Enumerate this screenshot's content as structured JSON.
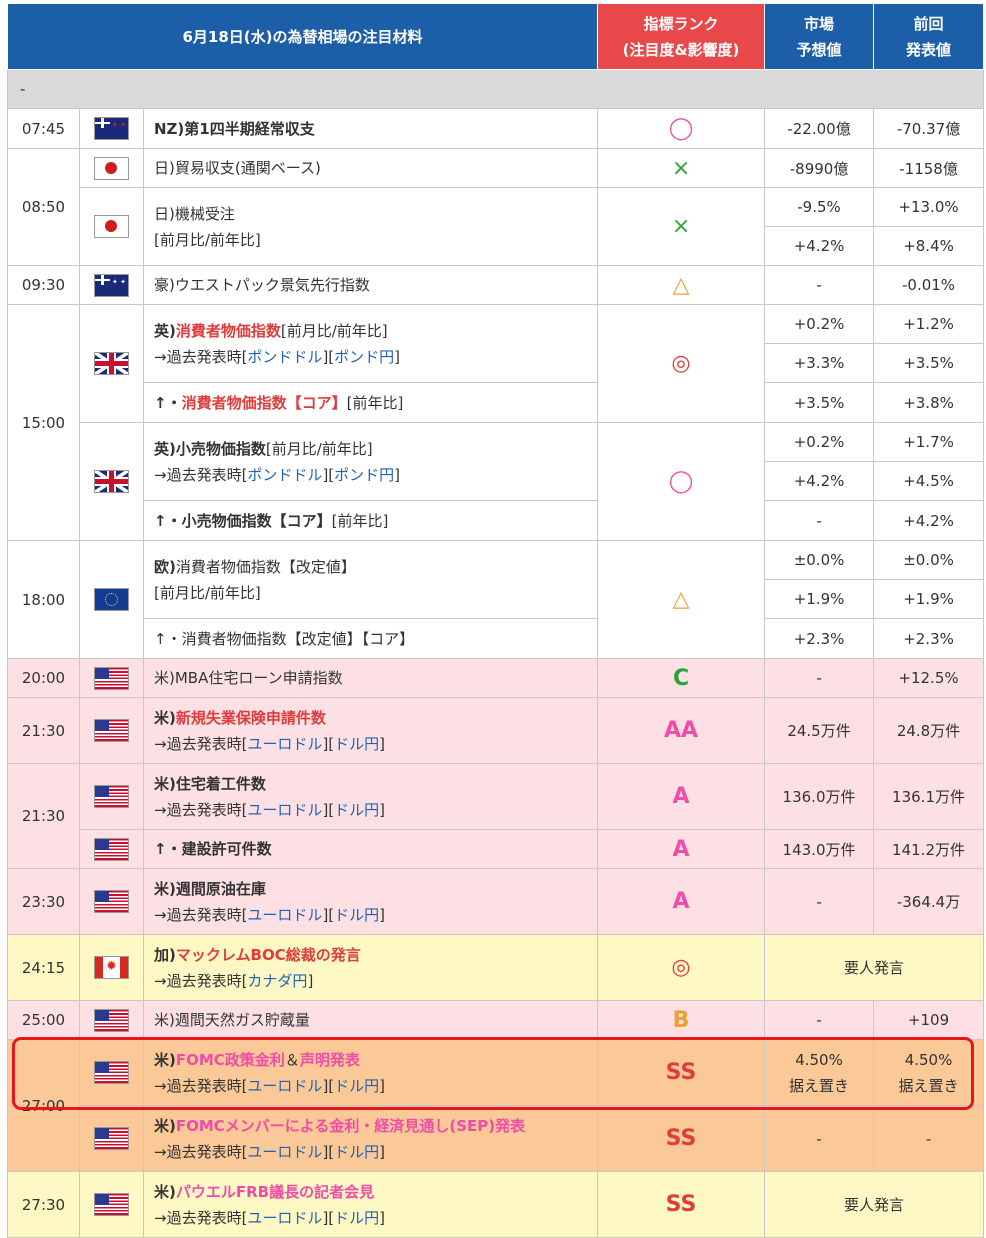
{
  "header": {
    "title": "6月18日(水)の為替相場の注目材料",
    "rank_line1": "指標ランク",
    "rank_line2": "(注目度&影響度)",
    "market_line1": "市場",
    "market_line2": "予想値",
    "prev_line1": "前回",
    "prev_line2": "発表値"
  },
  "separator": "-",
  "links": {
    "pound_dollar": "ポンドドル",
    "pound_yen": "ポンド円",
    "euro_dollar": "ユーロドル",
    "dollar_yen": "ドル円",
    "cad_yen": "カナダ円"
  },
  "text": {
    "past_prefix": "→過去発表時[",
    "bracket_mid": "][",
    "bracket_end": "]",
    "ampersand": "＆"
  },
  "rows": {
    "r1": {
      "time": "07:45",
      "flag": "nz-flag",
      "event": "NZ)第1四半期経常収支",
      "mark": "◯",
      "forecast": "-22.00億",
      "prev": "-70.37億"
    },
    "r2": {
      "time": "08:50",
      "flag": "jp-flag",
      "event": "日)貿易収支(通関ベース)",
      "mark": "×",
      "forecast": "-8990億",
      "prev": "-1158億"
    },
    "r3": {
      "flag": "jp-flag",
      "event": "日)機械受注",
      "sub": "[前月比/前年比]",
      "mark": "×",
      "forecast1": "-9.5%",
      "prev1": "+13.0%",
      "forecast2": "+4.2%",
      "prev2": "+8.4%"
    },
    "r4": {
      "time": "09:30",
      "flag": "au-flag",
      "event": "豪)ウエストパック景気先行指数",
      "mark": "△",
      "forecast": "-",
      "prev": "-0.01%"
    },
    "r5": {
      "time": "15:00",
      "flag": "uk-flag",
      "prefix": "英)",
      "event_hl": "消費者物価指数",
      "suffix": "[前月比/前年比]",
      "mark": "◎",
      "forecast1": "+0.2%",
      "prev1": "+1.2%",
      "forecast2": "+3.3%",
      "prev2": "+3.5%",
      "core_prefix": "↑・",
      "core_hl": "消費者物価指数【コア】",
      "core_suffix": "[前年比]",
      "forecast3": "+3.5%",
      "prev3": "+3.8%"
    },
    "r6": {
      "flag": "uk-flag",
      "prefix": "英)",
      "event_b": "小売物価指数",
      "suffix": "[前月比/前年比]",
      "mark": "◯",
      "forecast1": "+0.2%",
      "prev1": "+1.7%",
      "forecast2": "+4.2%",
      "prev2": "+4.5%",
      "core_prefix": "↑・",
      "core_b": "小売物価指数【コア】",
      "core_suffix": "[前年比]",
      "forecast3": "-",
      "prev3": "+4.2%"
    },
    "r7": {
      "time": "18:00",
      "flag": "eu-flag",
      "prefix": "欧)",
      "event": "消費者物価指数【改定値】",
      "sub": "[前月比/前年比]",
      "mark": "△",
      "forecast1": "±0.0%",
      "prev1": "±0.0%",
      "forecast2": "+1.9%",
      "prev2": "+1.9%",
      "core": "↑・消費者物価指数【改定値】【コア】",
      "forecast3": "+2.3%",
      "prev3": "+2.3%"
    },
    "r8": {
      "time": "20:00",
      "flag": "us-flag",
      "event": "米)MBA住宅ローン申請指数",
      "rank": "C",
      "forecast": "-",
      "prev": "+12.5%"
    },
    "r9": {
      "time": "21:30",
      "flag": "us-flag",
      "prefix": "米)",
      "event_hl": "新規失業保険申請件数",
      "rank": "AA",
      "forecast": "24.5万件",
      "prev": "24.8万件"
    },
    "r10": {
      "time": "21:30",
      "flag": "us-flag",
      "prefix": "米)",
      "event_b": "住宅着工件数",
      "rank": "A",
      "forecast": "136.0万件",
      "prev": "136.1万件",
      "sub_event": "↑・建設許可件数",
      "sub_rank": "A",
      "sub_forecast": "143.0万件",
      "sub_prev": "141.2万件"
    },
    "r11": {
      "time": "23:30",
      "flag": "us-flag",
      "prefix": "米)",
      "event_b": "週間原油在庫",
      "rank": "A",
      "forecast": "-",
      "prev": "-364.4万"
    },
    "r12": {
      "time": "24:15",
      "flag": "ca-flag",
      "prefix": "加)",
      "event_hl": "マックレムBOC総裁の発言",
      "mark": "◎",
      "note": "要人発言"
    },
    "r13": {
      "time": "25:00",
      "flag": "us-flag",
      "event": "米)週間天然ガス貯蔵量",
      "rank": "B",
      "forecast": "-",
      "prev": "+109"
    },
    "r14": {
      "time": "27:00",
      "flag": "us-flag",
      "prefix": "米)",
      "event_hl1": "FOMC政策金利",
      "event_hl2": "声明発表",
      "rank": "SS",
      "forecast_l1": "4.50%",
      "forecast_l2": "据え置き",
      "prev_l1": "4.50%",
      "prev_l2": "据え置き"
    },
    "r15": {
      "flag": "us-flag",
      "prefix": "米)",
      "event_hl": "FOMCメンバーによる金利・経済見通し(SEP)発表",
      "rank": "SS",
      "forecast": "-",
      "prev": "-"
    },
    "r16": {
      "time": "27:30",
      "flag": "us-flag",
      "prefix": "米)",
      "event_hl": "パウエルFRB議長の記者会見",
      "rank": "SS",
      "note": "要人発言"
    }
  },
  "colors": {
    "header_blue": "#1d5ea8",
    "rank_red": "#e9484a",
    "highlight": "#e8161b",
    "pink_row": "#fde0e4",
    "yellow_row": "#fdf8c4",
    "orange_row": "#fbc897"
  }
}
